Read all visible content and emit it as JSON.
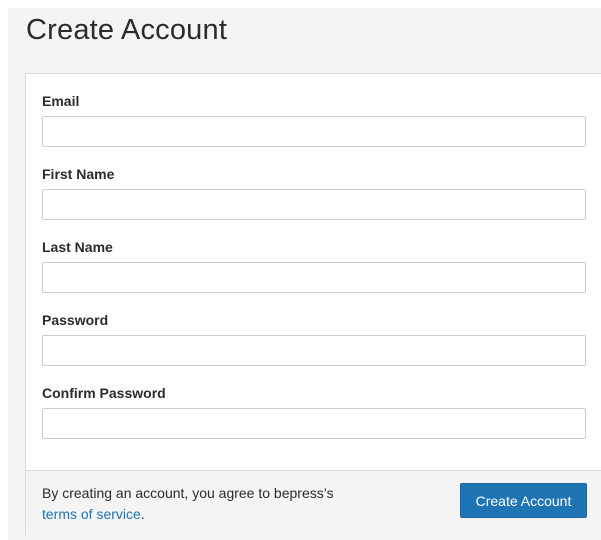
{
  "page": {
    "title": "Create Account"
  },
  "form": {
    "fields": [
      {
        "label": "Email",
        "value": "",
        "placeholder": ""
      },
      {
        "label": "First Name",
        "value": "",
        "placeholder": ""
      },
      {
        "label": "Last Name",
        "value": "",
        "placeholder": ""
      },
      {
        "label": "Password",
        "value": "",
        "placeholder": ""
      },
      {
        "label": "Confirm Password",
        "value": "",
        "placeholder": ""
      }
    ]
  },
  "footer": {
    "terms_prefix": "By creating an account, you agree to bepress’s ",
    "terms_link": "terms of service",
    "terms_suffix": ".",
    "submit_label": "Create Account"
  },
  "colors": {
    "accent": "#1f74b4",
    "footer_bg": "#f4f4f4",
    "border": "#d9d9d9"
  }
}
